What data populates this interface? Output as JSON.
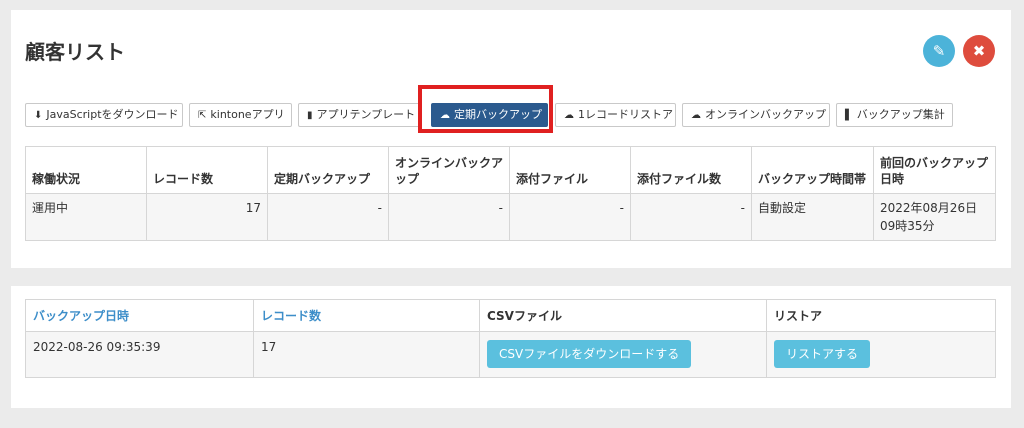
{
  "page": {
    "title": "顧客リスト"
  },
  "header_actions": {
    "edit_icon": "pencil-icon",
    "close_icon": "close-icon",
    "edit_color": "#4cb3d9",
    "close_color": "#de4c3d"
  },
  "toolbar": {
    "js_download": "JavaScriptをダウンロード",
    "kintone_app": "kintoneアプリ",
    "app_template": "アプリテンプレート",
    "scheduled_backup": "定期バックアップ",
    "one_record_restore": "1レコードリストア",
    "online_backup": "オンラインバックアップ",
    "backup_summary": "バックアップ集計"
  },
  "status_table": {
    "headers": [
      "稼働状況",
      "レコード数",
      "定期バックアップ",
      "オンラインバックアップ",
      "添付ファイル",
      "添付ファイル数",
      "バックアップ時間帯",
      "前回のバックアップ日時"
    ],
    "row": [
      "運用中",
      "17",
      "-",
      "-",
      "-",
      "-",
      "自動設定",
      "2022年08月26日09時35分"
    ]
  },
  "backup_table": {
    "headers": [
      "バックアップ日時",
      "レコード数",
      "CSVファイル",
      "リストア"
    ],
    "row": {
      "datetime": "2022-08-26 09:35:39",
      "records": "17",
      "csv_button": "CSVファイルをダウンロードする",
      "restore_button": "リストアする"
    }
  },
  "colors": {
    "active_button": "#2b5a8e",
    "highlight_border": "#e02020",
    "info_button": "#5bc0de",
    "link_header": "#3d8ec9"
  }
}
